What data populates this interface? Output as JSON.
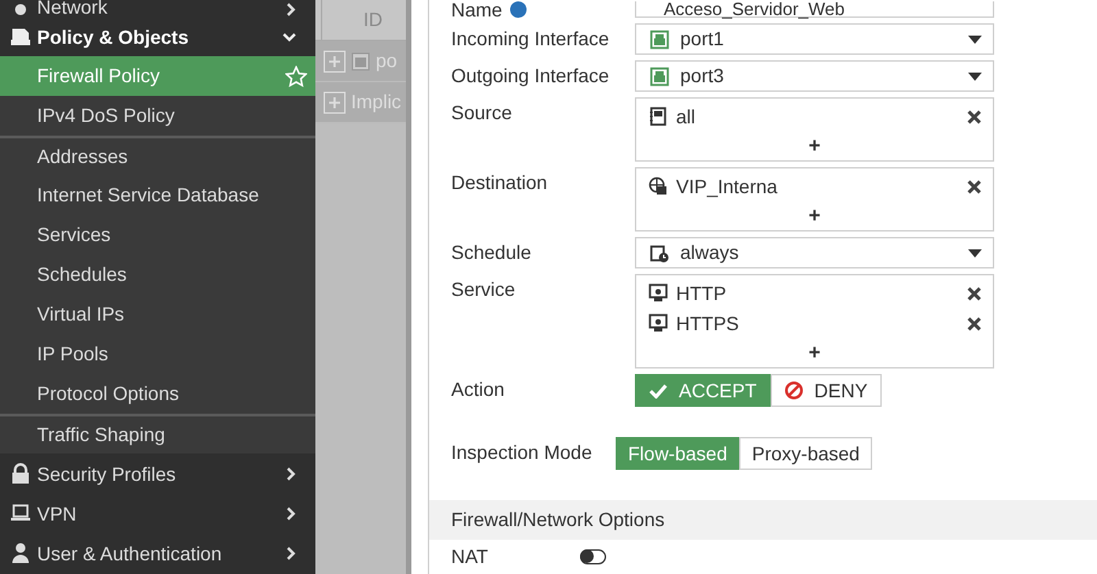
{
  "sidebar": {
    "items": [
      {
        "kind": "group",
        "label": "Network",
        "expanded": false
      },
      {
        "kind": "group",
        "label": "Policy & Objects",
        "expanded": true
      },
      {
        "kind": "sub",
        "label": "Firewall Policy",
        "selected": true,
        "divider_before": false
      },
      {
        "kind": "sub",
        "label": "IPv4 DoS Policy",
        "selected": false,
        "divider_before": false
      },
      {
        "kind": "sub",
        "label": "Addresses",
        "selected": false,
        "divider_before": true
      },
      {
        "kind": "sub",
        "label": "Internet Service Database",
        "selected": false,
        "divider_before": false
      },
      {
        "kind": "sub",
        "label": "Services",
        "selected": false,
        "divider_before": false
      },
      {
        "kind": "sub",
        "label": "Schedules",
        "selected": false,
        "divider_before": false
      },
      {
        "kind": "sub",
        "label": "Virtual IPs",
        "selected": false,
        "divider_before": false
      },
      {
        "kind": "sub",
        "label": "IP Pools",
        "selected": false,
        "divider_before": false
      },
      {
        "kind": "sub",
        "label": "Protocol Options",
        "selected": false,
        "divider_before": false
      },
      {
        "kind": "sub",
        "label": "Traffic Shaping",
        "selected": false,
        "divider_before": true
      },
      {
        "kind": "group",
        "label": "Security Profiles",
        "expanded": false
      },
      {
        "kind": "group",
        "label": "VPN",
        "expanded": false
      },
      {
        "kind": "group",
        "label": "User & Authentication",
        "expanded": false
      }
    ]
  },
  "table": {
    "columns": [
      "ID"
    ],
    "rows": [
      {
        "kind": "interface",
        "text": "po",
        "expanded": false
      },
      {
        "kind": "plain",
        "text": "Implic",
        "expanded": false
      }
    ]
  },
  "form": {
    "fields": [
      {
        "kind": "text",
        "label": "Name",
        "value": "Acceso_Servidor_Web"
      },
      {
        "kind": "select",
        "label": "Incoming Interface",
        "entry": {
          "kind": "interface",
          "text": "port1"
        }
      },
      {
        "kind": "select",
        "label": "Outgoing Interface",
        "entry": {
          "kind": "interface",
          "text": "port3"
        }
      },
      {
        "kind": "multi",
        "label": "Source",
        "entries": [
          {
            "kind": "address",
            "text": "all"
          }
        ],
        "add": "+"
      },
      {
        "kind": "multi",
        "label": "Destination",
        "entries": [
          {
            "kind": "vip",
            "text": "VIP_Interna"
          }
        ],
        "add": "+"
      },
      {
        "kind": "select",
        "label": "Schedule",
        "entry": {
          "kind": "schedule",
          "text": "always"
        }
      },
      {
        "kind": "multi",
        "label": "Service",
        "entries": [
          {
            "kind": "service",
            "text": "HTTP"
          },
          {
            "kind": "service",
            "text": "HTTPS"
          }
        ],
        "add": "+"
      },
      {
        "kind": "choice",
        "label": "Action",
        "options": [
          {
            "kind": "accept",
            "label": "ACCEPT",
            "selected": true
          },
          {
            "kind": "deny",
            "label": "DENY",
            "selected": false
          }
        ]
      },
      {
        "kind": "choice",
        "label": "Inspection Mode",
        "options": [
          {
            "kind": "plain",
            "label": "Flow-based",
            "selected": true
          },
          {
            "kind": "plain",
            "label": "Proxy-based",
            "selected": false
          }
        ]
      }
    ],
    "section": {
      "title": "Firewall/Network Options"
    },
    "nat": {
      "label": "NAT",
      "on": false
    }
  }
}
